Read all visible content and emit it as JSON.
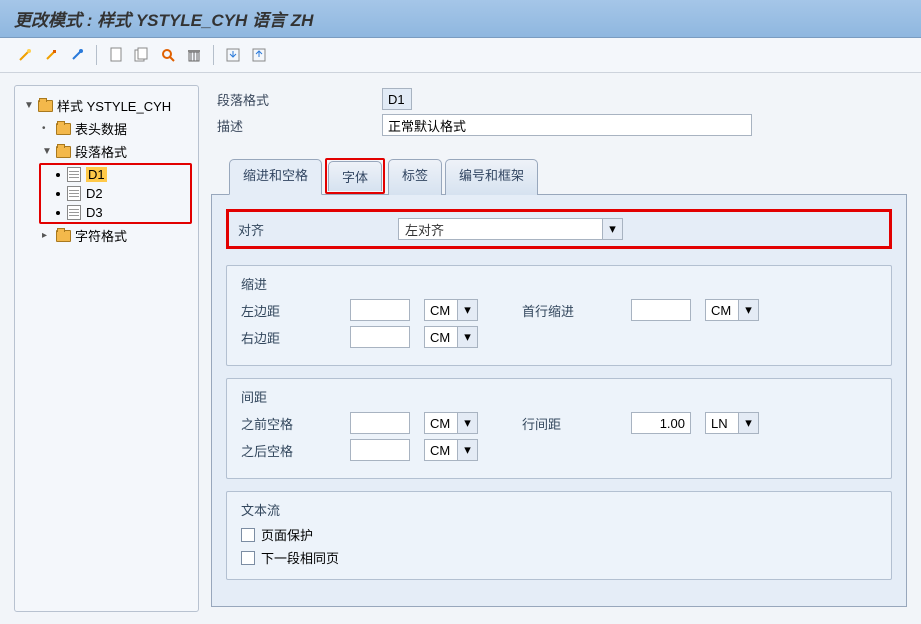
{
  "title": "更改模式 : 样式 YSTYLE_CYH 语言 ZH",
  "tree": {
    "root": "样式 YSTYLE_CYH",
    "header_data": "表头数据",
    "paragraph_format": "段落格式",
    "items": [
      "D1",
      "D2",
      "D3"
    ],
    "char_format": "字符格式"
  },
  "head": {
    "paragraph_label": "段落格式",
    "paragraph_value": "D1",
    "desc_label": "描述",
    "desc_value": "正常默认格式"
  },
  "tabs": {
    "t1": "缩进和空格",
    "t2": "字体",
    "t3": "标签",
    "t4": "编号和框架"
  },
  "align": {
    "label": "对齐",
    "value": "左对齐"
  },
  "groups": {
    "indent": {
      "title": "缩进",
      "left": "左边距",
      "right": "右边距",
      "first": "首行缩进",
      "unit": "CM"
    },
    "spacing": {
      "title": "间距",
      "before": "之前空格",
      "after": "之后空格",
      "lineh": "行间距",
      "lineh_val": "1.00",
      "unit": "CM",
      "unit2": "LN"
    },
    "textflow": {
      "title": "文本流",
      "protect": "页面保护",
      "nextsame": "下一段相同页"
    }
  }
}
